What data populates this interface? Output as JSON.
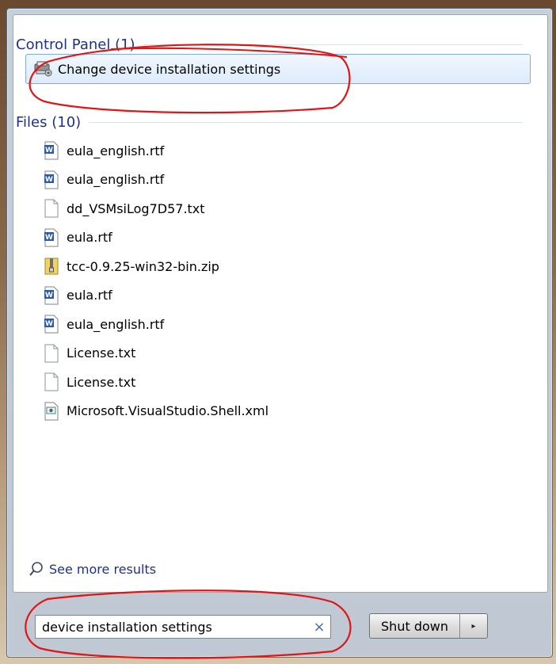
{
  "control_panel": {
    "header": "Control Panel (1)",
    "items": [
      {
        "label": "Change device installation settings",
        "icon": "device-settings-icon"
      }
    ]
  },
  "files": {
    "header": "Files (10)",
    "items": [
      {
        "name": "eula_english.rtf",
        "icon": "word-doc-icon"
      },
      {
        "name": "eula_english.rtf",
        "icon": "word-doc-icon"
      },
      {
        "name": "dd_VSMsiLog7D57.txt",
        "icon": "text-file-icon"
      },
      {
        "name": "eula.rtf",
        "icon": "word-doc-icon"
      },
      {
        "name": "tcc-0.9.25-win32-bin.zip",
        "icon": "zip-folder-icon"
      },
      {
        "name": "eula.rtf",
        "icon": "word-doc-icon"
      },
      {
        "name": "eula_english.rtf",
        "icon": "word-doc-icon"
      },
      {
        "name": "License.txt",
        "icon": "text-file-icon"
      },
      {
        "name": "License.txt",
        "icon": "text-file-icon"
      },
      {
        "name": "Microsoft.VisualStudio.Shell.xml",
        "icon": "xml-file-icon"
      }
    ]
  },
  "see_more": {
    "label": "See more results",
    "icon": "search-icon"
  },
  "search": {
    "value": "device installation settings",
    "clear_symbol": "×"
  },
  "shutdown": {
    "label": "Shut down",
    "arrow": "▸"
  },
  "colors": {
    "header_text": "#1e3287",
    "highlight_border": "#84acdd",
    "annotation_red": "#e01515"
  }
}
